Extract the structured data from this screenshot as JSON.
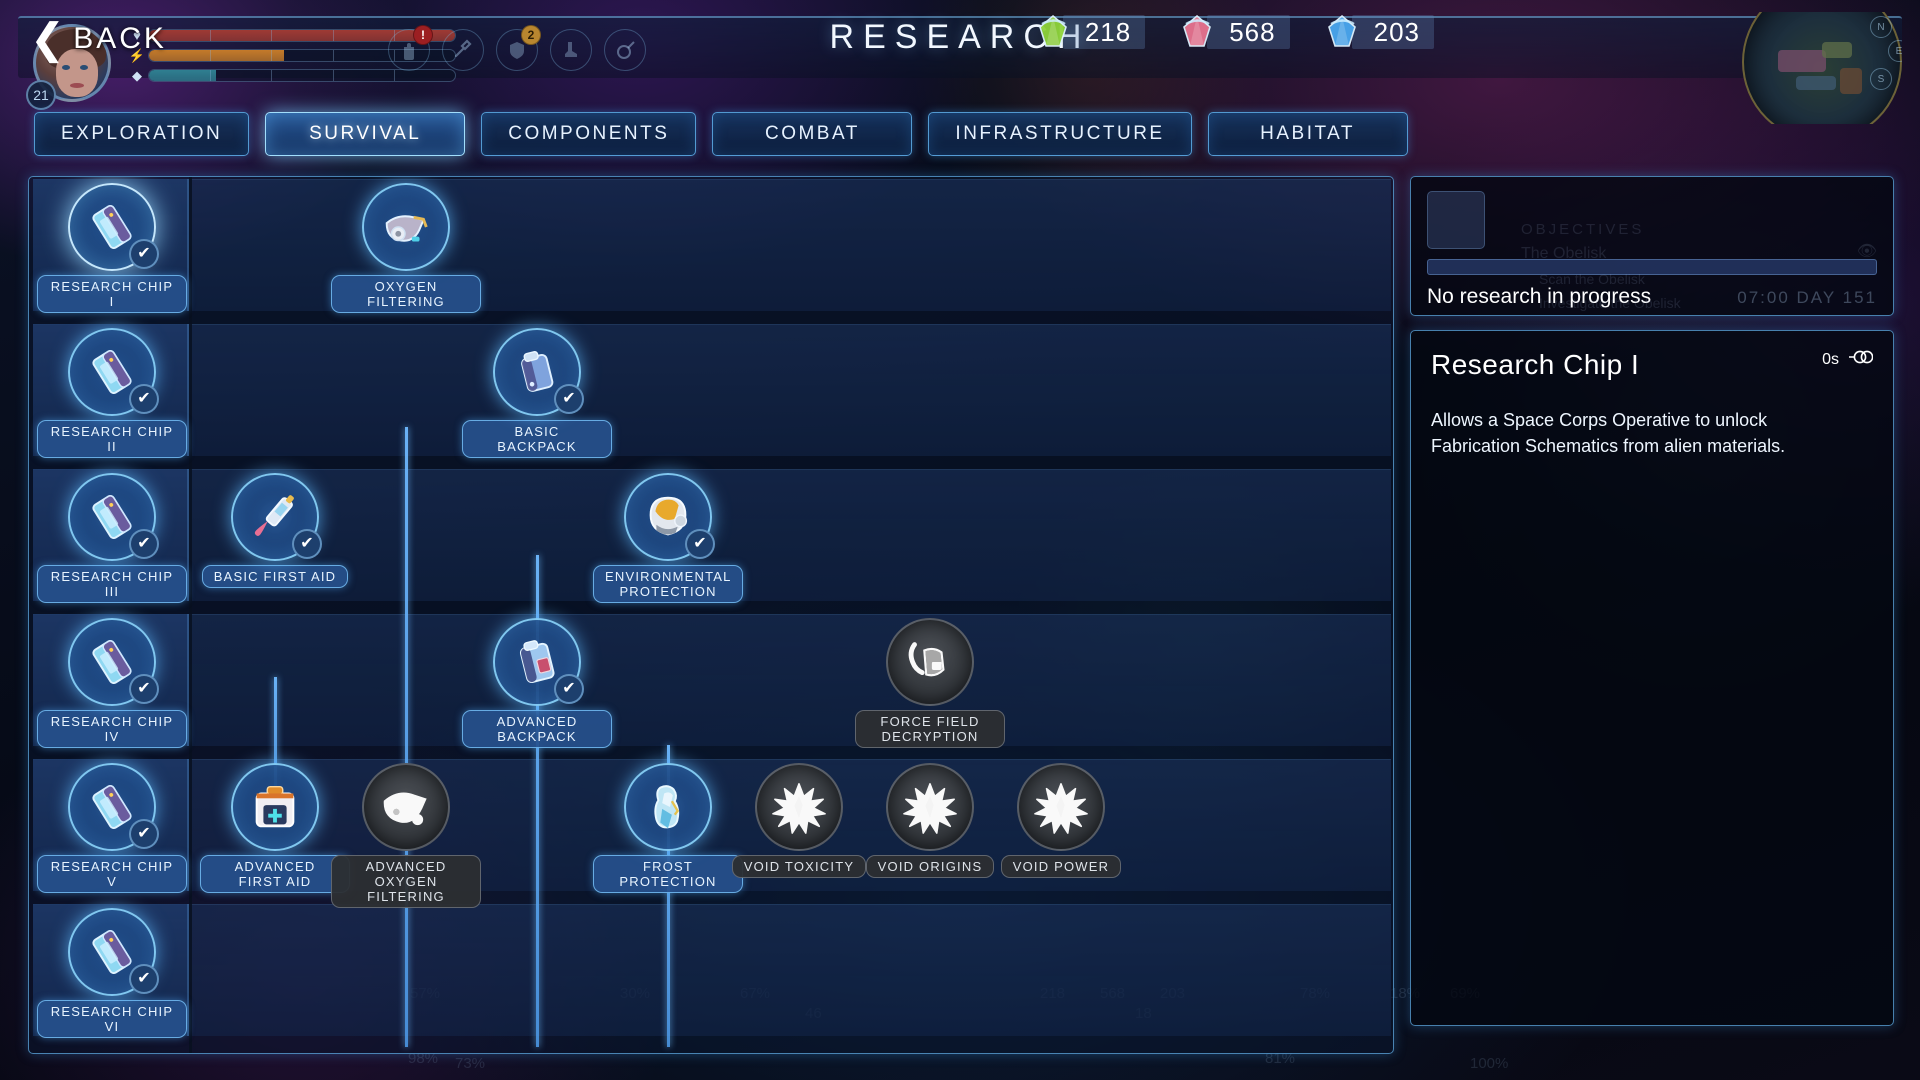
{
  "screen": {
    "title": "RESEARCH",
    "back_label": "BACK"
  },
  "hud": {
    "level": "21",
    "bars": [
      {
        "name": "health",
        "icon": "heart-icon",
        "percent": 100,
        "color": "#9e3a34",
        "segments": 5
      },
      {
        "name": "energy",
        "icon": "lightning-icon",
        "percent": 44,
        "color": "#c47a2a",
        "segments": 5
      },
      {
        "name": "oxygen",
        "icon": "droplet-icon",
        "percent": 22,
        "color": "#2f7f91",
        "segments": 5
      }
    ],
    "icons": [
      {
        "name": "backpack-icon",
        "badge": "!",
        "badge_type": "alert"
      },
      {
        "name": "hammer-icon",
        "badge": "",
        "badge_type": ""
      },
      {
        "name": "armor-icon",
        "badge": "2",
        "badge_type": "count"
      },
      {
        "name": "boot-icon",
        "badge": "",
        "badge_type": ""
      },
      {
        "name": "target-icon",
        "badge": "",
        "badge_type": ""
      }
    ]
  },
  "resources": [
    {
      "name": "biomass",
      "amount": "218",
      "color": "#8ed43a"
    },
    {
      "name": "organics",
      "amount": "568",
      "color": "#e8738f"
    },
    {
      "name": "crystal",
      "amount": "203",
      "color": "#4aa8f0"
    }
  ],
  "minimap": {
    "compass_n": "N",
    "compass_e": "E",
    "compass_s": "S"
  },
  "tabs": [
    {
      "label": "EXPLORATION",
      "active": false
    },
    {
      "label": "SURVIVAL",
      "active": true
    },
    {
      "label": "COMPONENTS",
      "active": false
    },
    {
      "label": "COMBAT",
      "active": false
    },
    {
      "label": "INFRASTRUCTURE",
      "active": false
    },
    {
      "label": "HABITAT",
      "active": false
    }
  ],
  "tree": {
    "nodes": [
      {
        "id": "chip1",
        "label": "RESEARCH CHIP I",
        "state": "done",
        "art": "chip",
        "col": 0,
        "row": 0
      },
      {
        "id": "chip2",
        "label": "RESEARCH CHIP II",
        "state": "done",
        "art": "chip",
        "col": 0,
        "row": 1
      },
      {
        "id": "chip3",
        "label": "RESEARCH CHIP III",
        "state": "done",
        "art": "chip",
        "col": 0,
        "row": 2
      },
      {
        "id": "chip4",
        "label": "RESEARCH CHIP IV",
        "state": "done",
        "art": "chip",
        "col": 0,
        "row": 3
      },
      {
        "id": "chip5",
        "label": "RESEARCH CHIP V",
        "state": "done",
        "art": "chip",
        "col": 0,
        "row": 4
      },
      {
        "id": "chip6",
        "label": "RESEARCH CHIP VI",
        "state": "done",
        "art": "chip",
        "col": 0,
        "row": 5
      },
      {
        "id": "oxyf",
        "label": "OXYGEN FILTERING",
        "state": "avail",
        "art": "mask",
        "col": 2,
        "row": 0
      },
      {
        "id": "bbp",
        "label": "BASIC BACKPACK",
        "state": "done",
        "art": "backpack",
        "col": 3,
        "row": 1
      },
      {
        "id": "bfa",
        "label": "BASIC FIRST AID",
        "state": "done",
        "art": "syringe",
        "col": 1,
        "row": 2
      },
      {
        "id": "envp",
        "label": "ENVIRONMENTAL PROTECTION",
        "state": "done",
        "art": "helmet",
        "col": 4,
        "row": 2
      },
      {
        "id": "abp",
        "label": "ADVANCED BACKPACK",
        "state": "done",
        "art": "backpack2",
        "col": 3,
        "row": 3
      },
      {
        "id": "ffd",
        "label": "FORCE FIELD DECRYPTION",
        "state": "locked",
        "art": "forcefield",
        "col": 6,
        "row": 3
      },
      {
        "id": "afa",
        "label": "ADVANCED FIRST AID",
        "state": "avail",
        "art": "medkit",
        "col": 1,
        "row": 4
      },
      {
        "id": "aoxy",
        "label": "ADVANCED OXYGEN FILTERING",
        "state": "locked",
        "art": "mask2",
        "col": 2,
        "row": 4
      },
      {
        "id": "frost",
        "label": "FROST PROTECTION",
        "state": "avail",
        "art": "suit",
        "col": 4,
        "row": 4
      },
      {
        "id": "vtox",
        "label": "VOID TOXICITY",
        "state": "locked",
        "art": "void",
        "col": 5,
        "row": 4
      },
      {
        "id": "vori",
        "label": "VOID ORIGINS",
        "state": "locked",
        "art": "void",
        "col": 6,
        "row": 4
      },
      {
        "id": "vpow",
        "label": "VOID POWER",
        "state": "locked",
        "art": "void",
        "col": 7,
        "row": 4
      }
    ]
  },
  "progress_panel": {
    "status": "No research in progress",
    "clock": "07:00 DAY 151"
  },
  "detail_panel": {
    "title": "Research Chip I",
    "cost_time": "0s",
    "cost_icon": "research-time-icon",
    "description": "Allows a Space Corps Operative to unlock Fabrication Schematics from alien materials."
  },
  "ghost_objectives": {
    "header": "OBJECTIVES",
    "quest": "The Obelisk",
    "items": [
      "Scan the Obelisk",
      "Investigate the Obelisk"
    ]
  },
  "ghost_numbers": [
    "98%",
    "73%",
    "57%",
    "30%",
    "67%",
    "46",
    "218",
    "568",
    "203",
    "18",
    "81%",
    "78%",
    "18%",
    "69%",
    "100%"
  ]
}
